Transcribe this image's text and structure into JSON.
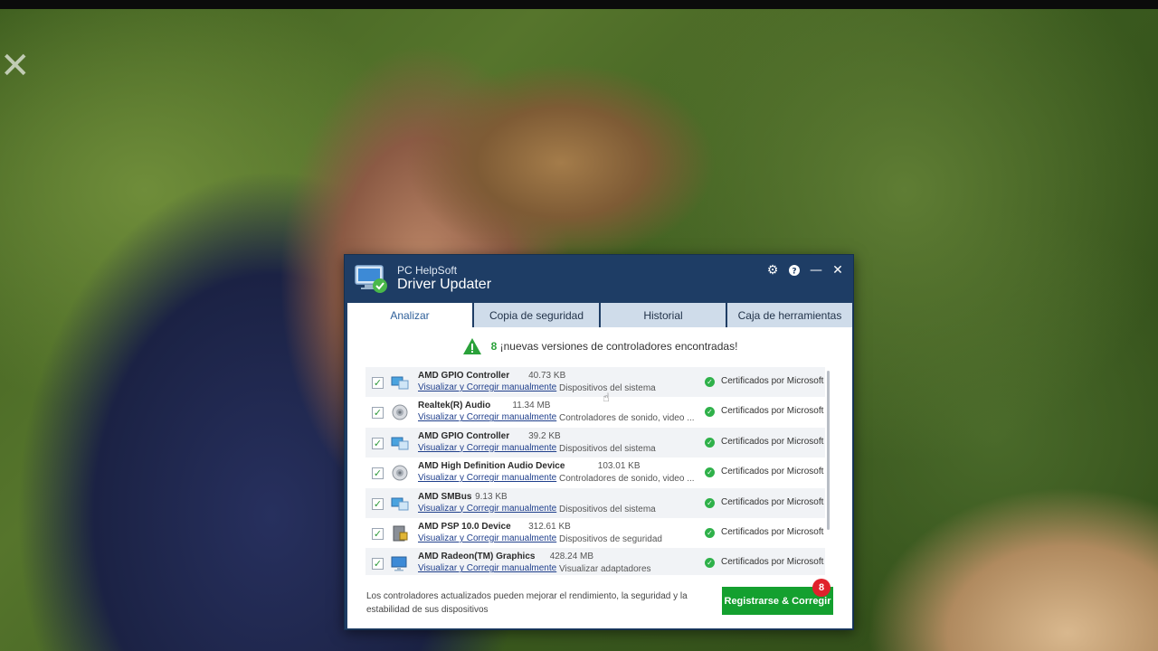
{
  "app": {
    "brand": "PC HelpSoft",
    "product": "Driver Updater",
    "controls": [
      "gear-icon",
      "help-icon",
      "minimize-icon",
      "close-icon"
    ]
  },
  "tabs": [
    {
      "label": "Analizar",
      "active": true
    },
    {
      "label": "Copia de seguridad",
      "active": false
    },
    {
      "label": "Historial",
      "active": false
    },
    {
      "label": "Caja de herramientas",
      "active": false
    }
  ],
  "notice": {
    "count": "8",
    "text": "¡nuevas versiones de controladores encontradas!"
  },
  "link_label": "Visualizar y Corregir manualmente",
  "cert_label": "Certificados por Microsoft",
  "drivers": [
    {
      "name": "AMD GPIO Controller",
      "size": "40.73 KB",
      "category": "Dispositivos del sistema",
      "icon": "system-device-icon",
      "checked": true
    },
    {
      "name": "Realtek(R) Audio",
      "size": "11.34 MB",
      "category": "Controladores de sonido, video ...",
      "icon": "speaker-icon",
      "checked": true
    },
    {
      "name": "AMD GPIO Controller",
      "size": "39.2 KB",
      "category": "Dispositivos del sistema",
      "icon": "system-device-icon",
      "checked": true
    },
    {
      "name": "AMD High Definition Audio Device",
      "size": "103.01 KB",
      "category": "Controladores de sonido, video ...",
      "icon": "speaker-icon",
      "checked": true
    },
    {
      "name": "AMD SMBus",
      "size": "9.13 KB",
      "category": "Dispositivos del sistema",
      "icon": "system-device-icon",
      "checked": true
    },
    {
      "name": "AMD PSP 10.0 Device",
      "size": "312.61 KB",
      "category": "Dispositivos de seguridad",
      "icon": "security-device-icon",
      "checked": true
    },
    {
      "name": "AMD Radeon(TM) Graphics",
      "size": "428.24 MB",
      "category": "Visualizar adaptadores",
      "icon": "display-adapter-icon",
      "checked": true
    }
  ],
  "footer": {
    "text": "Los controladores actualizados pueden mejorar el rendimiento, la seguridad y la estabilidad de sus dispositivos",
    "button": "Registrarse & Corregir",
    "badge": "8"
  },
  "colors": {
    "titlebar": "#1e3d65",
    "accent_green": "#14a02f",
    "badge_red": "#e0222c",
    "link": "#1f3f8c"
  }
}
